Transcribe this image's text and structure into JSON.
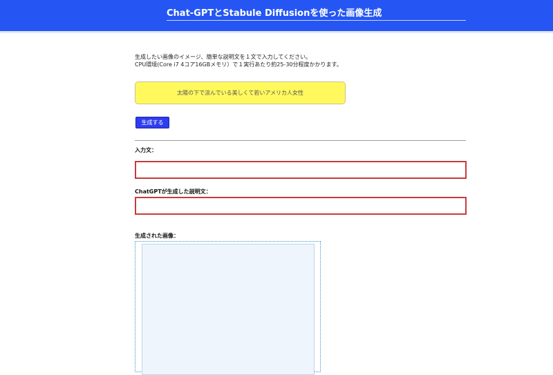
{
  "header": {
    "title": "Chat-GPTとStabule Diffusionを使った画像生成"
  },
  "instructions": {
    "line1": "生成したい画像のイメージ、簡単な説明文を１文で入力してください。",
    "line2": "CPU環境(Core i7 4コア16GBメモリ）で１実行あたり約25-30分程度かかります。"
  },
  "prompt": {
    "value": "太陽の下で涼んでいる美しくて若いアメリカ人女性",
    "placeholder": ""
  },
  "generate_button": {
    "label": "生成する"
  },
  "input_text_section": {
    "label": "入力文：",
    "value": ""
  },
  "chatgpt_section": {
    "label": "ChatGPTが生成した説明文：",
    "value": ""
  },
  "image_section": {
    "label": "生成された画像："
  },
  "colors": {
    "header_bg": "#2556f3",
    "prompt_bg": "#fff95e",
    "button_bg": "#2f3df0",
    "output_border": "#c73a3a"
  }
}
